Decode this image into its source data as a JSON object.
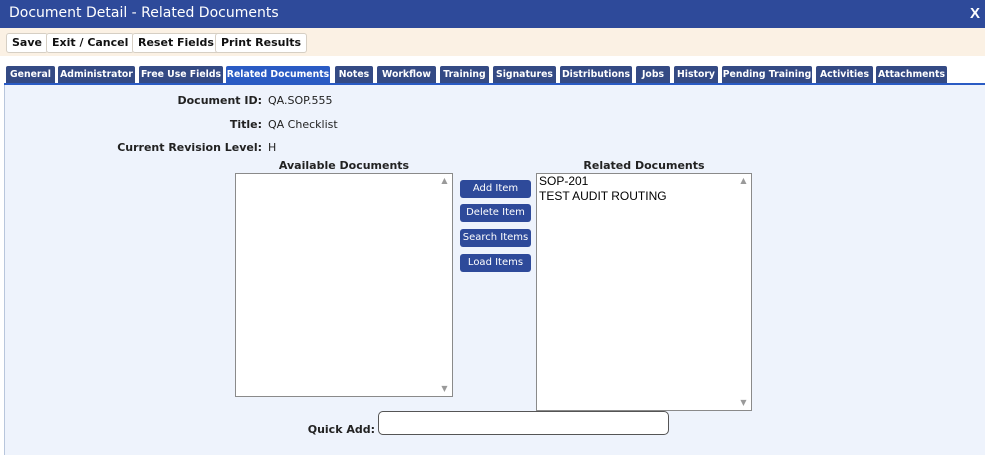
{
  "window": {
    "title": "Document Detail - Related Documents",
    "close_label": "X"
  },
  "toolbar": {
    "save": "Save",
    "exit": "Exit / Cancel",
    "reset": "Reset Fields",
    "print": "Print Results"
  },
  "tabs": [
    {
      "label": "General"
    },
    {
      "label": "Administrator"
    },
    {
      "label": "Free Use Fields"
    },
    {
      "label": "Related Documents",
      "active": true
    },
    {
      "label": "Notes"
    },
    {
      "label": "Workflow"
    },
    {
      "label": "Training"
    },
    {
      "label": "Signatures"
    },
    {
      "label": "Distributions"
    },
    {
      "label": "Jobs"
    },
    {
      "label": "History"
    },
    {
      "label": "Pending Training"
    },
    {
      "label": "Activities"
    },
    {
      "label": "Attachments"
    }
  ],
  "fields": {
    "document_id_label": "Document ID:",
    "document_id": "QA.SOP.555",
    "title_label": "Title:",
    "title": "QA Checklist",
    "revision_label": "Current Revision Level:",
    "revision": "H"
  },
  "available": {
    "header": "Available Documents",
    "items": []
  },
  "related": {
    "header": "Related Documents",
    "items": [
      "SOP-201",
      "TEST AUDIT ROUTING"
    ]
  },
  "actions": {
    "add": "Add Item",
    "delete": "Delete Item",
    "search": "Search Items",
    "load": "Load Items"
  },
  "quick_add": {
    "label": "Quick Add:",
    "value": ""
  },
  "colors": {
    "titlebar": "#2e4a9a",
    "toolbar_bg": "#fbf1e4",
    "tab": "#344a84",
    "tab_active": "#2a5bc4",
    "panel_bg": "#eef3fc"
  }
}
